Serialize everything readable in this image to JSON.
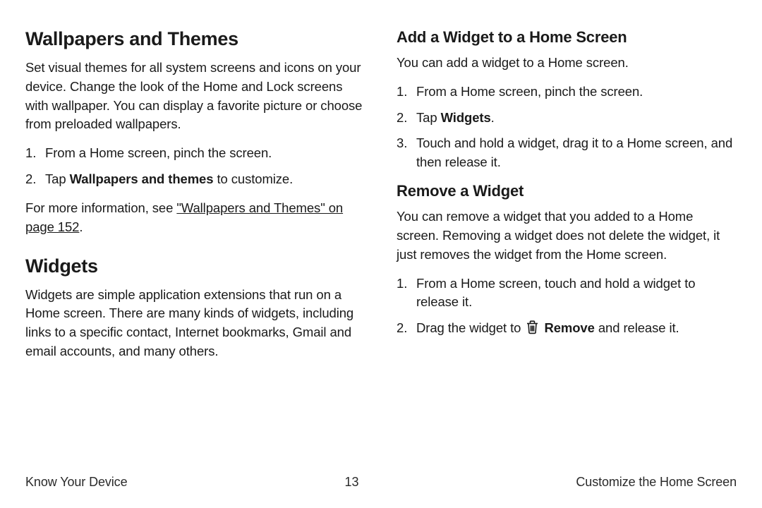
{
  "left": {
    "h2a": "Wallpapers and Themes",
    "p1": "Set visual themes for all system screens and icons on your device. Change the look of the Home and Lock screens with wallpaper. You can display a favorite picture or choose from preloaded wallpapers.",
    "steps1": {
      "s1": "From a Home screen, pinch the screen.",
      "s2a": "Tap ",
      "s2b": "Wallpapers and themes",
      "s2c": " to customize."
    },
    "more_a": "For more information, see ",
    "more_link": "\"Wallpapers and Themes\" on page 152",
    "more_c": ".",
    "h2b": "Widgets",
    "p2": "Widgets are simple application extensions that run on a Home screen. There are many kinds of widgets, including links to a specific contact, Internet bookmarks, Gmail and email accounts, and many others."
  },
  "right": {
    "h3a": "Add a Widget to a Home Screen",
    "p1": "You can add a widget to a Home screen.",
    "add_steps": {
      "s1": "From a Home screen, pinch the screen.",
      "s2a": "Tap ",
      "s2b": "Widgets",
      "s2c": ".",
      "s3": "Touch and hold a widget, drag it to a Home screen, and then release it."
    },
    "h3b": "Remove a Widget",
    "p2": "You can remove a widget that you added to a Home screen. Removing a widget does not delete the widget, it just removes the widget from the Home screen.",
    "rem_steps": {
      "s1": "From a Home screen, touch and hold a widget to release it.",
      "s2a": "Drag the widget to ",
      "s2b": "Remove",
      "s2c": " and release it."
    }
  },
  "footer": {
    "left": "Know Your Device",
    "center": "13",
    "right": "Customize the Home Screen"
  }
}
